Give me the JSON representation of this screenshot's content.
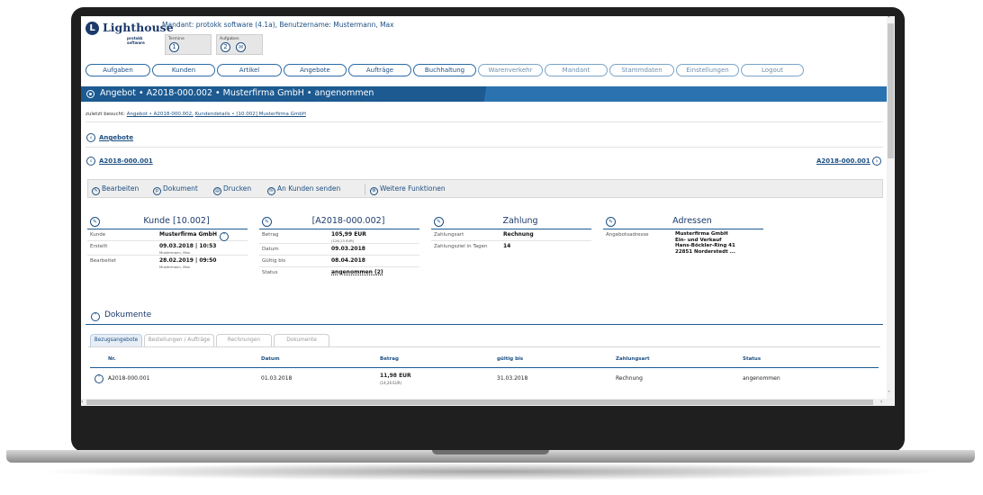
{
  "header": {
    "logo_text": "Lighthouse",
    "logo_sub": "protokk software",
    "mandant_line": "Mandant: protokk software (4.1a), Benutzername: Mustermann, Max",
    "termine_label": "Termine",
    "termine_count": "1",
    "aufgaben_label": "Aufgaben",
    "aufgaben_count": "2"
  },
  "nav": [
    "Aufgaben",
    "Kunden",
    "Artikel",
    "Angebote",
    "Aufträge",
    "Buchhaltung",
    "Warenverkehr",
    "Mandant",
    "Stammdaten",
    "Einstellungen",
    "Logout"
  ],
  "title": "Angebot • A2018-000.002 • Musterfirma GmbH • angenommen",
  "visited": {
    "prefix": "zuletzt besucht:",
    "link1": "Angebot • A2018-000.002,",
    "link2": "Kundendetails • [10.002] Musterfirma GmbH"
  },
  "breadcrumb": {
    "back": "Angebote",
    "prev": "A2018-000.001",
    "next": "A2018-000.001"
  },
  "toolbar": {
    "edit": "Bearbeiten",
    "document": "Dokument",
    "print": "Drucken",
    "send": "An Kunden senden",
    "more": "Weitere Funktionen"
  },
  "kunde": {
    "title": "Kunde [10.002]",
    "rows": [
      {
        "k": "Kunde",
        "v": "Musterfirma GmbH",
        "s": ""
      },
      {
        "k": "Erstellt",
        "v": "09.03.2018 | 10:53",
        "s": "Mustermann, Max"
      },
      {
        "k": "Bearbeitet",
        "v": "28.02.2019 | 09:50",
        "s": "Mustermann, Max"
      }
    ]
  },
  "angebot": {
    "title": "[A2018-000.002]",
    "rows": [
      {
        "k": "Betrag",
        "v": "105,99 EUR",
        "s": "(126,13 EUR)"
      },
      {
        "k": "Datum",
        "v": "09.03.2018",
        "s": ""
      },
      {
        "k": "Gültig bis",
        "v": "08.04.2018",
        "s": ""
      },
      {
        "k": "Status",
        "v": "angenommen (2)",
        "s": ""
      }
    ]
  },
  "zahlung": {
    "title": "Zahlung",
    "rows": [
      {
        "k": "Zahlungsart",
        "v": "Rechnung"
      },
      {
        "k": "Zahlungsziel in Tagen",
        "v": "14"
      }
    ]
  },
  "adressen": {
    "title": "Adressen",
    "label": "Angebotsadresse",
    "lines": [
      "Musterfirma GmbH",
      "Ein- und Verkauf",
      "Hans-Böckler-Ring 41",
      "22851 Norderstedt ..."
    ]
  },
  "dokumente": {
    "title": "Dokumente",
    "tabs": [
      "Bezugsangebote",
      "Bestellungen / Aufträge",
      "Rechnungen",
      "Dokumente"
    ],
    "columns": [
      "Nr.",
      "Datum",
      "Betrag",
      "gültig bis",
      "Zahlungsart",
      "Status"
    ],
    "rows": [
      {
        "nr": "A2018-000.001",
        "datum": "01.03.2018",
        "betrag": "11,98 EUR",
        "betrag_sub": "(14,26 EUR)",
        "gueltig": "31.03.2018",
        "zahlungsart": "Rechnung",
        "status": "angenommen"
      }
    ]
  },
  "colors": {
    "primary": "#1c5a91",
    "accent": "#2b72b0",
    "link": "#1c4f82"
  }
}
